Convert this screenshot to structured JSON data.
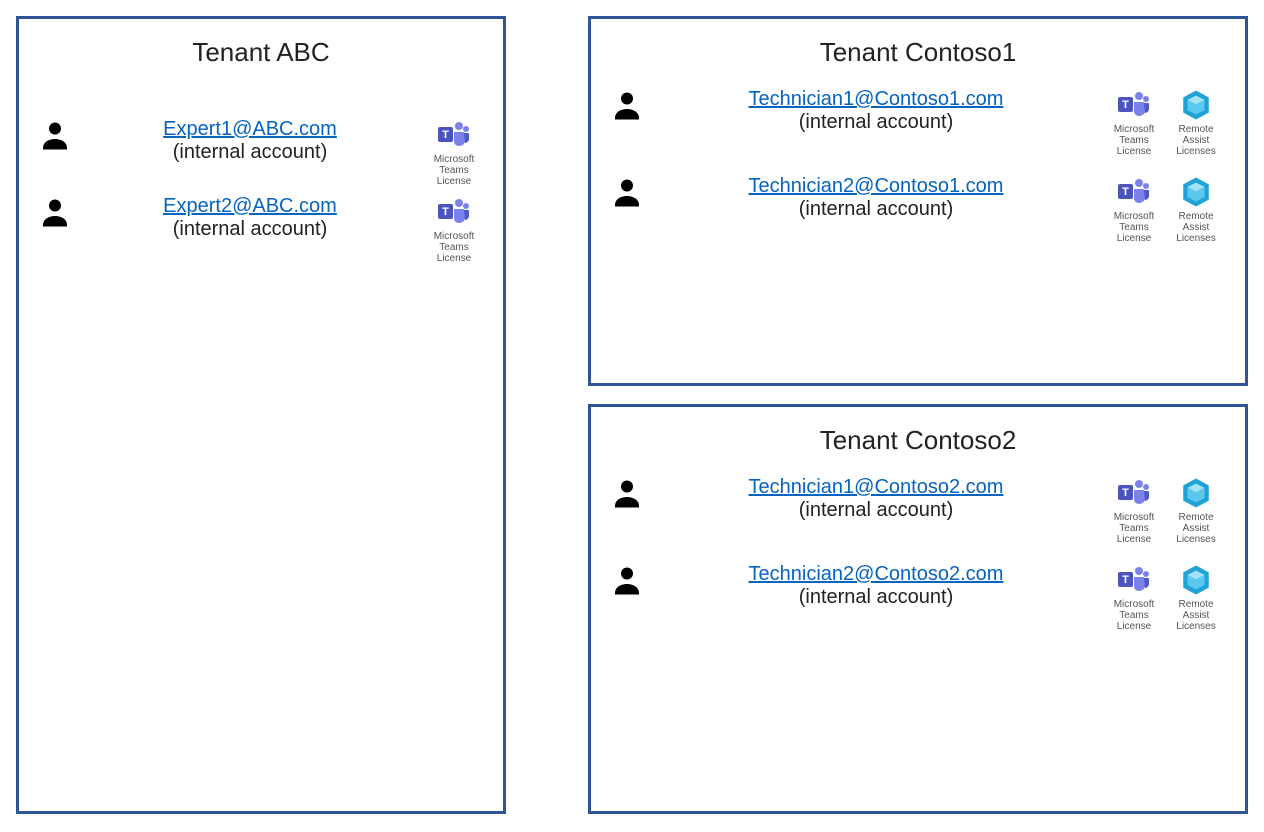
{
  "tenants": [
    {
      "title": "Tenant ABC",
      "users": [
        {
          "email": "Expert1@ABC.com",
          "note": "(internal account)",
          "licenses": [
            "teams"
          ]
        },
        {
          "email": "Expert2@ABC.com",
          "note": "(internal account)",
          "licenses": [
            "teams"
          ]
        }
      ]
    },
    {
      "title": "Tenant Contoso1",
      "users": [
        {
          "email": "Technician1@Contoso1.com",
          "note": "(internal account)",
          "licenses": [
            "teams",
            "remote_assist"
          ]
        },
        {
          "email": "Technician2@Contoso1.com",
          "note": "(internal account)",
          "licenses": [
            "teams",
            "remote_assist"
          ]
        }
      ]
    },
    {
      "title": "Tenant Contoso2",
      "users": [
        {
          "email": "Technician1@Contoso2.com",
          "note": "(internal account)",
          "licenses": [
            "teams",
            "remote_assist"
          ]
        },
        {
          "email": "Technician2@Contoso2.com",
          "note": "(internal account)",
          "licenses": [
            "teams",
            "remote_assist"
          ]
        }
      ]
    }
  ],
  "license_labels": {
    "teams": "Microsoft Teams License",
    "remote_assist": "Remote Assist Licenses"
  }
}
